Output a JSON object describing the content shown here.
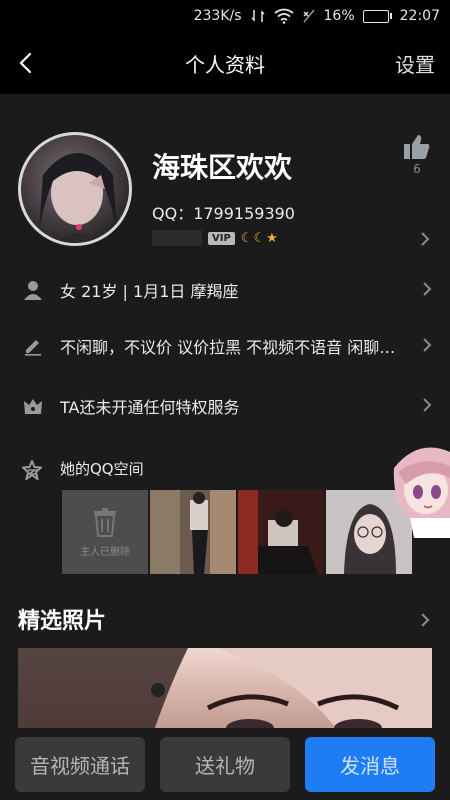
{
  "status_bar": {
    "speed": "233K/s",
    "battery": "16%",
    "battery_level": 0.16,
    "time": "22:07"
  },
  "nav": {
    "title": "个人资料",
    "settings": "设置"
  },
  "profile": {
    "nickname": "海珠区欢欢",
    "qq": "QQ：1799159390",
    "vip": "VIP",
    "level_icons": "☾☾★",
    "likes": "6"
  },
  "rows": {
    "basic": "女  21岁  |  1月1日  摩羯座",
    "signature": "不闲聊，不议价 议价拉黑 不视频不语音 闲聊勿扰",
    "privilege": "TA还未开通任何特权服务"
  },
  "qzone": {
    "title": "她的QQ空间",
    "deleted_label": "主人已删除"
  },
  "featured": {
    "title": "精选照片"
  },
  "actions": {
    "call": "音视频通话",
    "gift": "送礼物",
    "message": "发消息"
  }
}
